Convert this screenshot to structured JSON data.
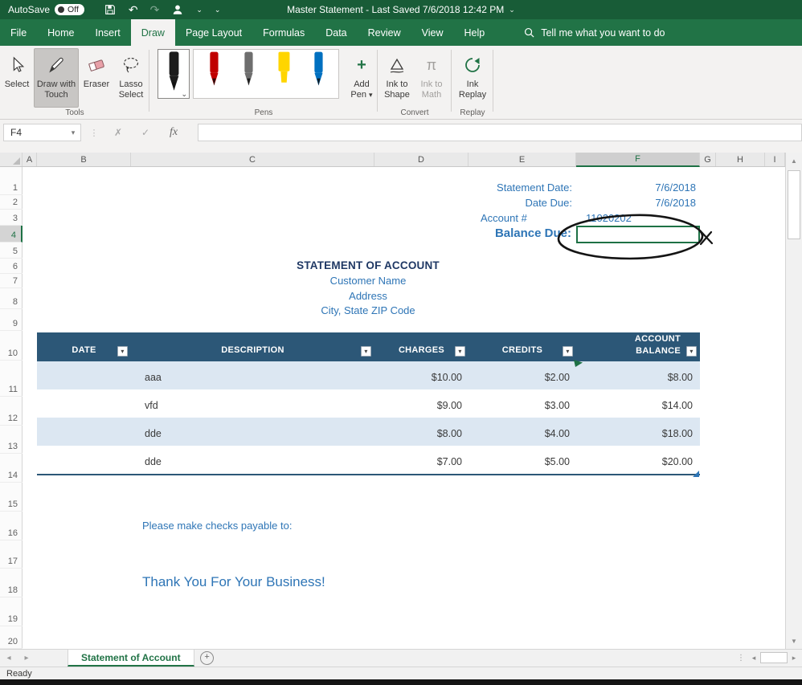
{
  "titlebar": {
    "autosave_label": "AutoSave",
    "autosave_state": "Off",
    "title": "Master Statement  -  Last Saved 7/6/2018 12:42 PM"
  },
  "menubar": {
    "tabs": [
      "File",
      "Home",
      "Insert",
      "Draw",
      "Page Layout",
      "Formulas",
      "Data",
      "Review",
      "View",
      "Help"
    ],
    "active_tab": "Draw",
    "search_text": "Tell me what you want to do"
  },
  "ribbon": {
    "tools": {
      "group_label": "Tools",
      "select": "Select",
      "draw_with_touch": "Draw with Touch",
      "eraser": "Eraser",
      "lasso_select": "Lasso Select",
      "active_tool": "Draw with Touch"
    },
    "pens": {
      "group_label": "Pens",
      "add_pen": "Add Pen",
      "pen_colors": [
        "#1b1b1b",
        "#c00000",
        "#6e6e6e",
        "#ffd500",
        "#0070c0"
      ]
    },
    "convert": {
      "group_label": "Convert",
      "ink_to_shape": "Ink to Shape",
      "ink_to_math": "Ink to Math"
    },
    "replay": {
      "group_label": "Replay",
      "ink_replay": "Ink Replay"
    }
  },
  "formula_bar": {
    "name_box": "F4",
    "fx_label": "fx",
    "formula_value": ""
  },
  "grid": {
    "columns": [
      "A",
      "B",
      "C",
      "D",
      "E",
      "F",
      "G",
      "H",
      "I"
    ],
    "row_count": 20,
    "selected_column": "F",
    "selected_row": 4
  },
  "sheet": {
    "statement_date_label": "Statement Date:",
    "statement_date_value": "7/6/2018",
    "date_due_label": "Date Due:",
    "date_due_value": "7/6/2018",
    "account_label": "Account #",
    "account_value": "11020202",
    "balance_due_label": "Balance Due:",
    "title": "STATEMENT OF ACCOUNT",
    "customer_name": "Customer Name",
    "address": "Address",
    "city_line": "City, State  ZIP Code",
    "checks_note": "Please make checks payable to:",
    "thank_you": "Thank You For Your Business!"
  },
  "table": {
    "headers": {
      "date": "DATE",
      "description": "DESCRIPTION",
      "charges": "CHARGES",
      "credits": "CREDITS",
      "balance": "ACCOUNT BALANCE"
    },
    "rows": [
      {
        "date": "",
        "description": "aaa",
        "charges": "$10.00",
        "credits": "$2.00",
        "balance": "$8.00"
      },
      {
        "date": "",
        "description": "vfd",
        "charges": "$9.00",
        "credits": "$3.00",
        "balance": "$14.00"
      },
      {
        "date": "",
        "description": "dde",
        "charges": "$8.00",
        "credits": "$4.00",
        "balance": "$18.00"
      },
      {
        "date": "",
        "description": "dde",
        "charges": "$7.00",
        "credits": "$5.00",
        "balance": "$20.00"
      }
    ]
  },
  "sheet_tabs": {
    "active": "Statement of Account"
  },
  "status": {
    "mode": "Ready"
  },
  "icons": {
    "chevron_down": "⌄",
    "dropdown": "▾",
    "undo": "↶",
    "redo": "↷",
    "up": "▲",
    "down": "▼",
    "left": "◂",
    "right": "▸",
    "plus": "+",
    "cancel": "✗",
    "enter": "✓",
    "dots": "⋮",
    "pi": "π"
  },
  "colors": {
    "title_green": "#185C37",
    "excel_green": "#217346",
    "selection_green": "#1E7145",
    "table_header_blue": "#2C5777",
    "band_blue": "#DCE7F2",
    "text_blue": "#2E75B6",
    "heading_navy": "#1F3864",
    "ink_black": "#141414"
  }
}
